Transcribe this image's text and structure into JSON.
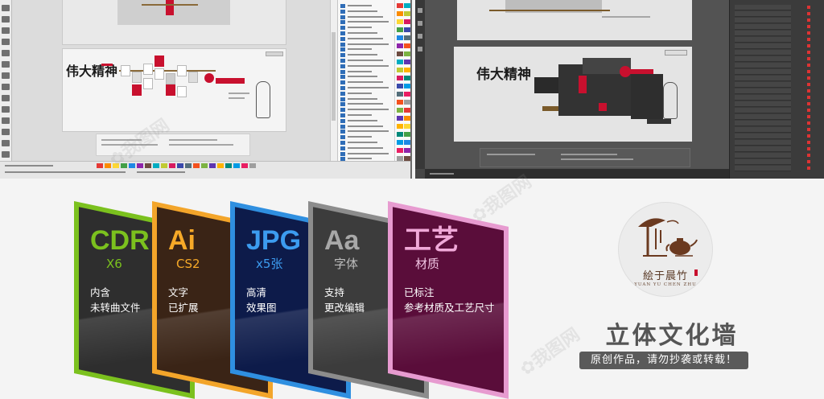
{
  "top_left_app": {
    "panel_rows": 30,
    "palette_colors": [
      "#e53935",
      "#fb8c00",
      "#fdd835",
      "#43a047",
      "#1e88e5",
      "#8e24aa",
      "#6d4c41",
      "#00acc1",
      "#c0ca33",
      "#d81b60",
      "#3949ab",
      "#546e7a",
      "#f4511e",
      "#7cb342",
      "#5e35b1",
      "#ffb300",
      "#00897b",
      "#039be5",
      "#e91e63",
      "#9e9e9e"
    ]
  },
  "top_right_app": {
    "layer_rows": 26
  },
  "cards": [
    {
      "big": "CDR",
      "sub": "X6",
      "desc1": "内含",
      "desc2": "未转曲文件",
      "border": "#7bc11e",
      "fill": "#2e2e2e",
      "big_color": "#7bc11e",
      "sub_color": "#7bc11e"
    },
    {
      "big": "Ai",
      "sub": "CS2",
      "desc1": "文字",
      "desc2": "已扩展",
      "border": "#f3a52a",
      "fill": "#3a2416",
      "big_color": "#f6a928",
      "sub_color": "#f6a928"
    },
    {
      "big": "JPG",
      "sub": "x5张",
      "desc1": "高清",
      "desc2": "效果图",
      "border": "#2f8fe0",
      "fill": "#0d1b4a",
      "big_color": "#3c9cf0",
      "sub_color": "#3c9cf0"
    },
    {
      "big": "Aa",
      "sub": "字体",
      "desc1": "支持",
      "desc2": "更改编辑",
      "border": "#8c8c8c",
      "fill": "#3c3c3c",
      "big_color": "#a8a8a8",
      "sub_color": "#bdbdbd"
    },
    {
      "big": "工艺",
      "sub": "材质",
      "desc1": "已标注",
      "desc2": "参考材质及工艺尺寸",
      "border": "#e79bd0",
      "fill": "#5a0d3a",
      "big_color": "#f0a8d8",
      "sub_color": "#f0c4e2"
    }
  ],
  "logo": {
    "name_cn": "絵于晨竹",
    "name_en": "YUAN YU CHEN ZHU"
  },
  "product_title": "立体文化墙",
  "notice": "原创作品，请勿抄袭或转载！",
  "colors": {
    "accent_red": "#c8102e",
    "title_gray": "#555555",
    "badge_bg": "#5a5a5a"
  }
}
